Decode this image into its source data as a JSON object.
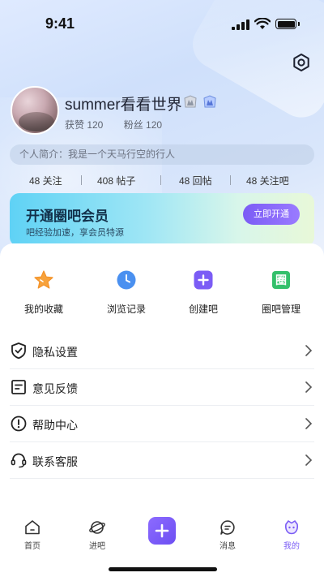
{
  "status": {
    "time": "9:41"
  },
  "profile": {
    "name": "summer看看世界",
    "likes_label": "获赞 120",
    "fans_label": "粉丝 120",
    "bio": "个人简介：我是一个天马行空的行人"
  },
  "counts": [
    {
      "label": "48 关注"
    },
    {
      "label": "408 帖子"
    },
    {
      "label": "48 回帖"
    },
    {
      "label": "48 关注吧"
    }
  ],
  "vip": {
    "title": "开通圈吧会员",
    "subtitle": "吧经验加速，享会员特源",
    "button": "立即开通"
  },
  "shortcuts": [
    {
      "label": "我的收藏",
      "icon": "star-icon"
    },
    {
      "label": "浏览记录",
      "icon": "clock-icon"
    },
    {
      "label": "创建吧",
      "icon": "plus-icon"
    },
    {
      "label": "圈吧管理",
      "icon": "quan-icon",
      "glyph": "圈"
    }
  ],
  "menu": [
    {
      "label": "隐私设置",
      "icon": "shield-icon"
    },
    {
      "label": "意见反馈",
      "icon": "feedback-icon"
    },
    {
      "label": "帮助中心",
      "icon": "help-icon"
    },
    {
      "label": "联系客服",
      "icon": "headset-icon"
    }
  ],
  "tabs": [
    {
      "label": "首页",
      "icon": "home-icon"
    },
    {
      "label": "进吧",
      "icon": "planet-icon"
    },
    {
      "label": "消息",
      "icon": "message-icon"
    },
    {
      "label": "我的",
      "icon": "profile-icon",
      "active": true
    }
  ],
  "colors": {
    "accent": "#7a5cf5",
    "vip_start": "#5fd2f5",
    "star": "#f7a23b",
    "clock": "#4a90f0",
    "create": "#7b5cf5",
    "quan": "#33c06b"
  }
}
